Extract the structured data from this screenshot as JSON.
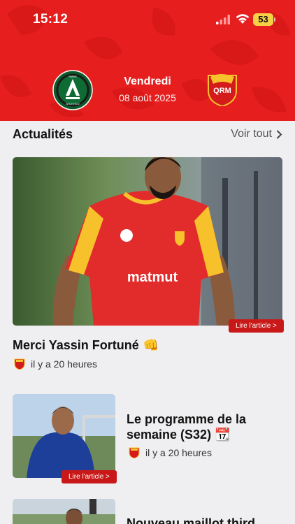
{
  "status_bar": {
    "time": "15:12",
    "battery": "53"
  },
  "match": {
    "day": "Vendredi",
    "date": "08 août 2025",
    "home_team": "Paris Atletico",
    "away_team": "QRM"
  },
  "section": {
    "title": "Actualités",
    "see_all": "Voir tout"
  },
  "articles": [
    {
      "title": "Merci Yassin Fortuné",
      "emoji": "👊",
      "time": "il y a 20 heures",
      "read_label": "Lire l'article >"
    },
    {
      "title": "Le programme de la semaine (S32)",
      "emoji": "📆",
      "time": "il y a 20 heures",
      "read_label": "Lire l'article >"
    },
    {
      "title": "Nouveau maillot third"
    }
  ],
  "colors": {
    "header_red": "#e61e1e",
    "button_red": "#c81818",
    "page_bg": "#efeff1"
  },
  "icons": [
    "signal-icon",
    "wifi-icon",
    "battery-icon",
    "chevron-right-icon",
    "club-logo-icon"
  ]
}
